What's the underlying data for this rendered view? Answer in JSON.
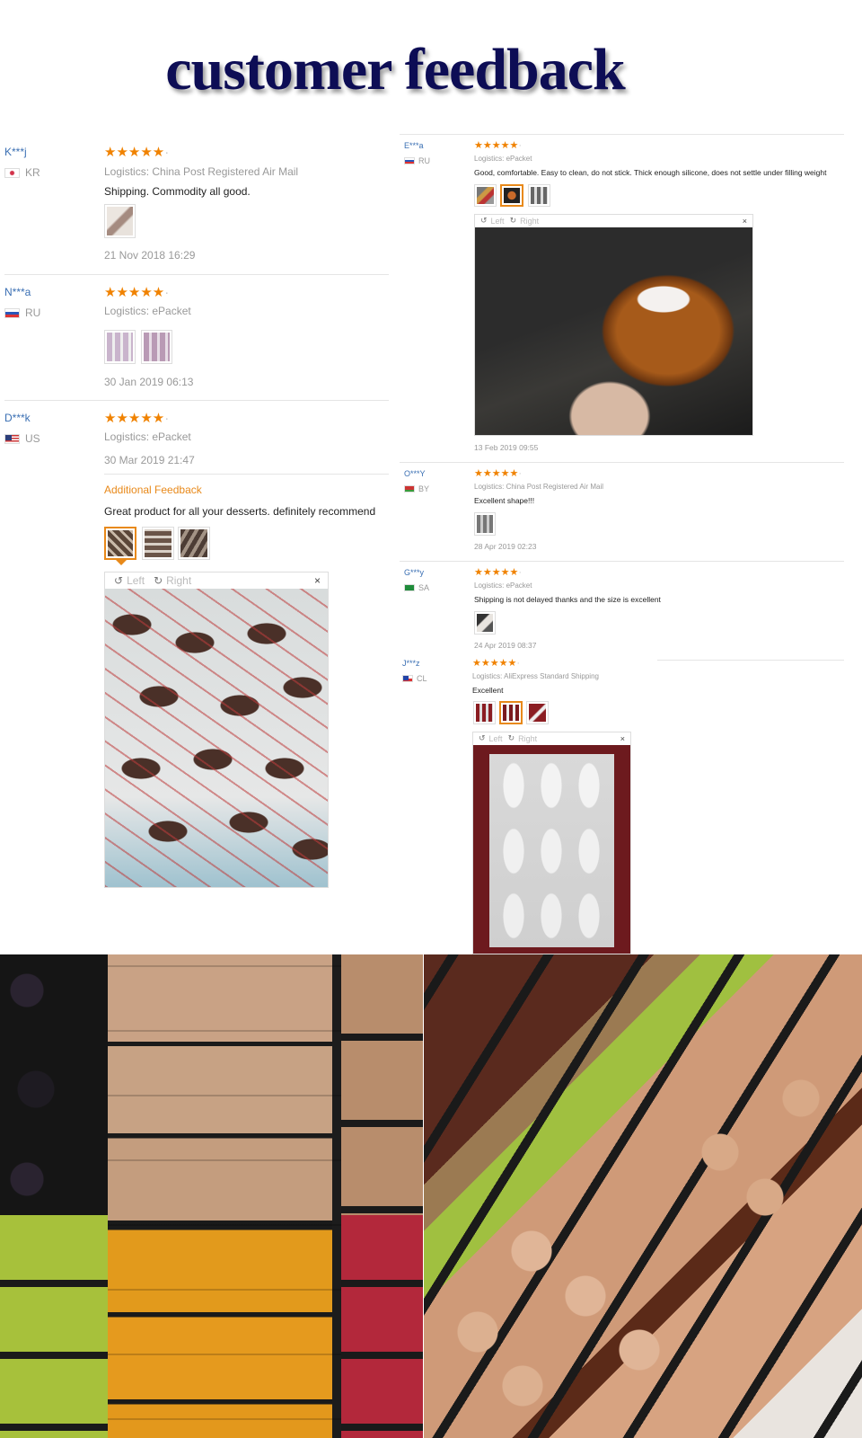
{
  "title": "customer feedback",
  "viewer_controls": {
    "left": "Left",
    "right": "Right",
    "close": "×"
  },
  "colors": {
    "link": "#3a6fb3",
    "stars": "#f08200",
    "accent": "#e8891a",
    "title": "#0d0d55"
  },
  "left_reviews": [
    {
      "user": "K***j",
      "country": "KR",
      "rating": 5,
      "logistics": "Logistics: China Post Registered Air Mail",
      "text": "Shipping. Commodity all good.",
      "date": "21 Nov 2018 16:29",
      "photo_count": 1
    },
    {
      "user": "N***a",
      "country": "RU",
      "rating": 5,
      "logistics": "Logistics: ePacket",
      "text": "",
      "date": "30 Jan 2019 06:13",
      "photo_count": 2
    },
    {
      "user": "D***k",
      "country": "US",
      "rating": 5,
      "logistics": "Logistics: ePacket",
      "date": "30 Mar 2019 21:47",
      "additional_label": "Additional Feedback",
      "additional_text": "Great product for all your desserts. definitely recommend",
      "photo_count": 3
    }
  ],
  "right_reviews": [
    {
      "user": "E***a",
      "country": "RU",
      "rating": 5,
      "logistics": "Logistics: ePacket",
      "text": "Good, comfortable. Easy to clean, do not stick. Thick enough silicone, does not settle under filling weight",
      "date": "13 Feb 2019 09:55",
      "photo_count": 3
    },
    {
      "user": "O***Y",
      "country": "BY",
      "rating": 5,
      "logistics": "Logistics: China Post Registered Air Mail",
      "text": "Excellent shape!!!",
      "date": "28 Apr 2019 02:23",
      "photo_count": 1
    },
    {
      "user": "G***y",
      "country": "SA",
      "rating": 5,
      "logistics": "Logistics: ePacket",
      "text": "Shipping is not delayed thanks and the size is excellent",
      "date": "24 Apr 2019 08:37",
      "photo_count": 1
    },
    {
      "user": "J***z",
      "country": "CL",
      "rating": 5,
      "logistics": "Logistics: AliExpress Standard Shipping",
      "text": "Excellent",
      "photo_count": 3
    }
  ]
}
